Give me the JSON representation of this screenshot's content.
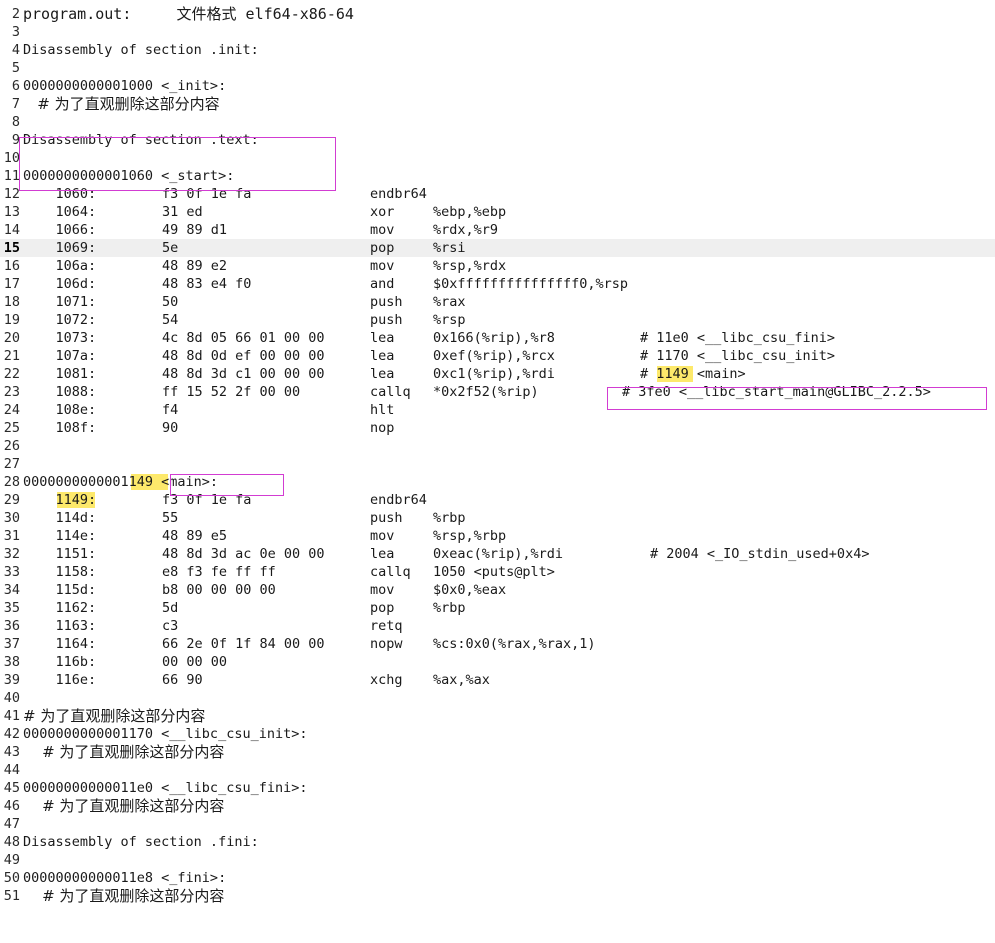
{
  "editor": {
    "highlight_color": "#fde96b",
    "annotation_box_color": "#d23cd2",
    "current_line": 15,
    "lines": [
      {
        "n": "2",
        "text": "program.out:     文件格式 elf64-x86-64"
      },
      {
        "n": "3",
        "text": ""
      },
      {
        "n": "4",
        "text": "Disassembly of section .init:"
      },
      {
        "n": "5",
        "text": ""
      },
      {
        "n": "6",
        "text": "0000000000001000 <_init>:"
      },
      {
        "n": "7",
        "text": "   # 为了直观删除这部分内容"
      },
      {
        "n": "8",
        "text": ""
      },
      {
        "n": "9",
        "text": "Disassembly of section .text:"
      },
      {
        "n": "10",
        "text": ""
      },
      {
        "n": "11",
        "text": "0000000000001060 <_start>:"
      },
      {
        "n": "12",
        "text": "    1060:",
        "bytes": "f3 0f 1e fa",
        "mnem": "endbr64",
        "ops": "",
        "cmt": ""
      },
      {
        "n": "13",
        "text": "    1064:",
        "bytes": "31 ed",
        "mnem": "xor",
        "ops": "%ebp,%ebp",
        "cmt": ""
      },
      {
        "n": "14",
        "text": "    1066:",
        "bytes": "49 89 d1",
        "mnem": "mov",
        "ops": "%rdx,%r9",
        "cmt": ""
      },
      {
        "n": "15",
        "text": "    1069:",
        "bytes": "5e",
        "mnem": "pop",
        "ops": "%rsi",
        "cmt": ""
      },
      {
        "n": "16",
        "text": "    106a:",
        "bytes": "48 89 e2",
        "mnem": "mov",
        "ops": "%rsp,%rdx",
        "cmt": ""
      },
      {
        "n": "17",
        "text": "    106d:",
        "bytes": "48 83 e4 f0",
        "mnem": "and",
        "ops": "$0xfffffffffffffff0,%rsp",
        "cmt": ""
      },
      {
        "n": "18",
        "text": "    1071:",
        "bytes": "50",
        "mnem": "push",
        "ops": "%rax",
        "cmt": ""
      },
      {
        "n": "19",
        "text": "    1072:",
        "bytes": "54",
        "mnem": "push",
        "ops": "%rsp",
        "cmt": ""
      },
      {
        "n": "20",
        "text": "    1073:",
        "bytes": "4c 8d 05 66 01 00 00",
        "mnem": "lea",
        "ops": "0x166(%rip),%r8",
        "cmt": "# 11e0 <__libc_csu_fini>"
      },
      {
        "n": "21",
        "text": "    107a:",
        "bytes": "48 8d 0d ef 00 00 00",
        "mnem": "lea",
        "ops": "0xef(%rip),%rcx",
        "cmt": "# 1170 <__libc_csu_init>"
      },
      {
        "n": "22",
        "text": "    1081:",
        "bytes": "48 8d 3d c1 00 00 00",
        "mnem": "lea",
        "ops": "0xc1(%rip),%rdi",
        "cmt": "# 1149 <main>"
      },
      {
        "n": "23",
        "text": "    1088:",
        "bytes": "ff 15 52 2f 00 00",
        "mnem": "callq",
        "ops": "*0x2f52(%rip)",
        "cmt": "# 3fe0 <__libc_start_main@GLIBC_2.2.5>"
      },
      {
        "n": "24",
        "text": "    108e:",
        "bytes": "f4",
        "mnem": "hlt",
        "ops": "",
        "cmt": ""
      },
      {
        "n": "25",
        "text": "    108f:",
        "bytes": "90",
        "mnem": "nop",
        "ops": "",
        "cmt": ""
      },
      {
        "n": "26",
        "text": ""
      },
      {
        "n": "27",
        "text": ""
      },
      {
        "n": "28",
        "text": "0000000000001149 <main>:"
      },
      {
        "n": "29",
        "text": "    1149:",
        "bytes": "f3 0f 1e fa",
        "mnem": "endbr64",
        "ops": "",
        "cmt": ""
      },
      {
        "n": "30",
        "text": "    114d:",
        "bytes": "55",
        "mnem": "push",
        "ops": "%rbp",
        "cmt": ""
      },
      {
        "n": "31",
        "text": "    114e:",
        "bytes": "48 89 e5",
        "mnem": "mov",
        "ops": "%rsp,%rbp",
        "cmt": ""
      },
      {
        "n": "32",
        "text": "    1151:",
        "bytes": "48 8d 3d ac 0e 00 00",
        "mnem": "lea",
        "ops": "0xeac(%rip),%rdi",
        "cmt": "# 2004 <_IO_stdin_used+0x4>"
      },
      {
        "n": "33",
        "text": "    1158:",
        "bytes": "e8 f3 fe ff ff",
        "mnem": "callq",
        "ops": "1050 <puts@plt>",
        "cmt": ""
      },
      {
        "n": "34",
        "text": "    115d:",
        "bytes": "b8 00 00 00 00",
        "mnem": "mov",
        "ops": "$0x0,%eax",
        "cmt": ""
      },
      {
        "n": "35",
        "text": "    1162:",
        "bytes": "5d",
        "mnem": "pop",
        "ops": "%rbp",
        "cmt": ""
      },
      {
        "n": "36",
        "text": "    1163:",
        "bytes": "c3",
        "mnem": "retq",
        "ops": "",
        "cmt": ""
      },
      {
        "n": "37",
        "text": "    1164:",
        "bytes": "66 2e 0f 1f 84 00 00",
        "mnem": "nopw",
        "ops": "%cs:0x0(%rax,%rax,1)",
        "cmt": ""
      },
      {
        "n": "38",
        "text": "    116b:",
        "bytes": "00 00 00",
        "mnem": "",
        "ops": "",
        "cmt": ""
      },
      {
        "n": "39",
        "text": "    116e:",
        "bytes": "66 90",
        "mnem": "xchg",
        "ops": "%ax,%ax",
        "cmt": ""
      },
      {
        "n": "40",
        "text": ""
      },
      {
        "n": "41",
        "text": "# 为了直观删除这部分内容"
      },
      {
        "n": "42",
        "text": "0000000000001170 <__libc_csu_init>:"
      },
      {
        "n": "43",
        "text": "    # 为了直观删除这部分内容"
      },
      {
        "n": "44",
        "text": ""
      },
      {
        "n": "45",
        "text": "00000000000011e0 <__libc_csu_fini>:"
      },
      {
        "n": "46",
        "text": "    # 为了直观删除这部分内容"
      },
      {
        "n": "47",
        "text": ""
      },
      {
        "n": "48",
        "text": "Disassembly of section .fini:"
      },
      {
        "n": "49",
        "text": ""
      },
      {
        "n": "50",
        "text": "00000000000011e8 <_fini>:"
      },
      {
        "n": "51",
        "text": "    # 为了直观删除这部分内容"
      }
    ]
  }
}
